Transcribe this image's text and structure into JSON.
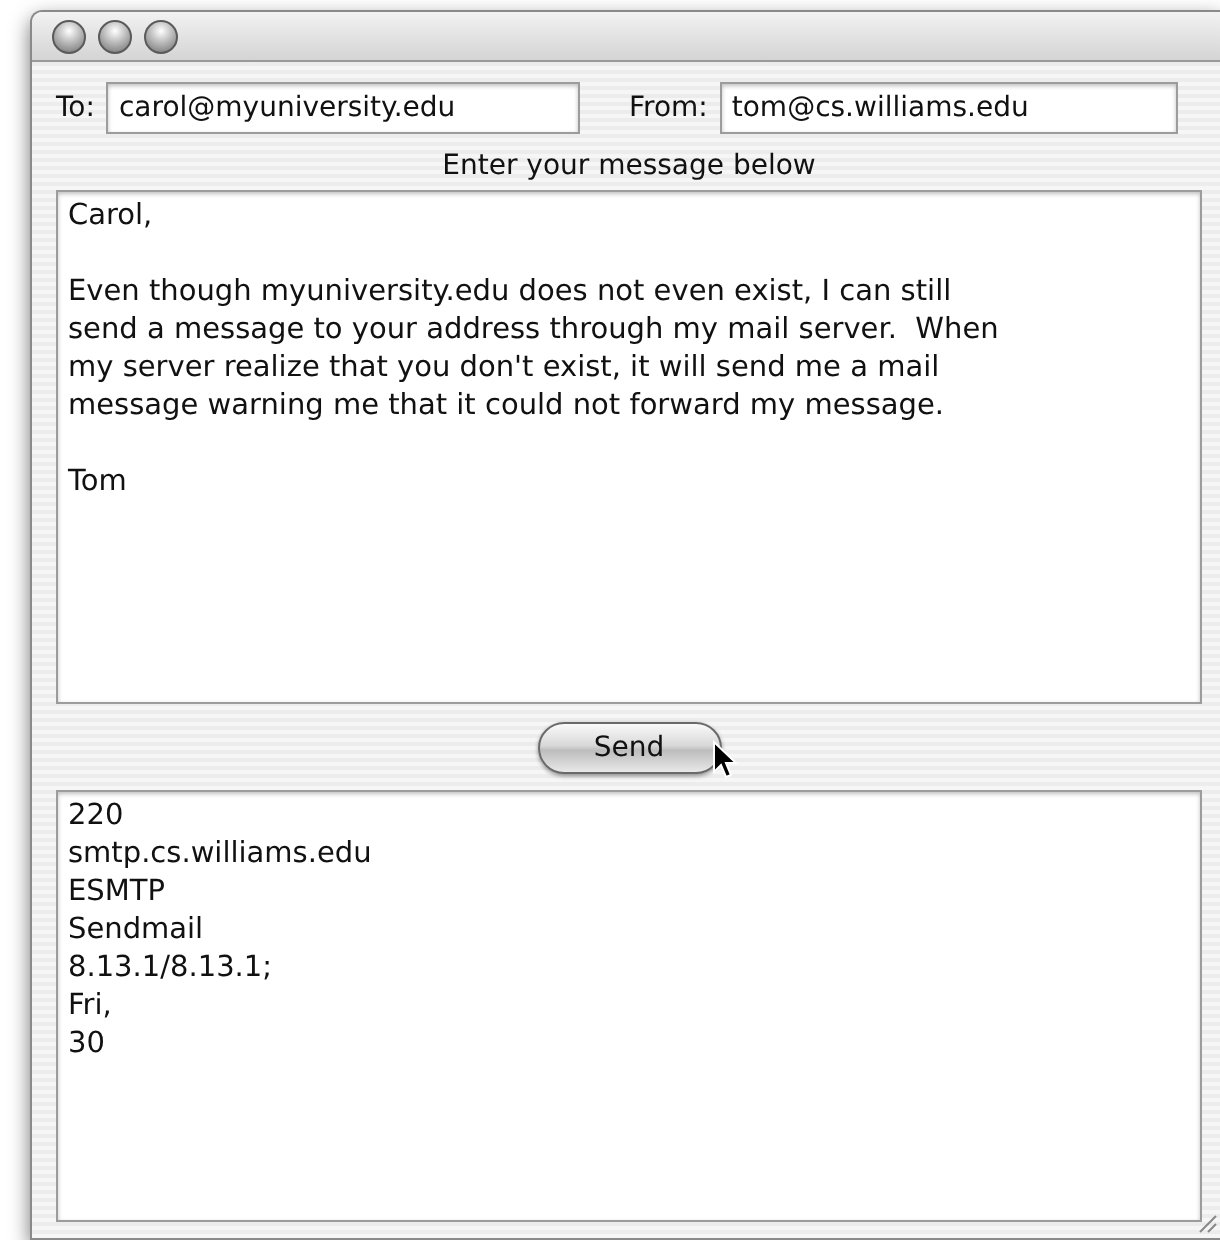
{
  "to": {
    "label": "To:",
    "value": "carol@myuniversity.edu"
  },
  "from": {
    "label": "From:",
    "value": "tom@cs.williams.edu"
  },
  "prompt": "Enter your message below",
  "message": [
    {
      "lines": [
        "Carol,"
      ]
    },
    {
      "lines": [
        "Even though myuniversity.edu does not even exist, I can still",
        "send a message to your address through my mail server.  When",
        "my server realize that you don't exist, it will send me a mail",
        "message warning me that it could not forward my message."
      ]
    },
    {
      "lines": [
        "Tom"
      ]
    }
  ],
  "send_button": {
    "label": "Send"
  },
  "response": [
    "220",
    "smtp.cs.williams.edu",
    "ESMTP",
    "Sendmail",
    "8.13.1/8.13.1;",
    "Fri,",
    "30"
  ]
}
